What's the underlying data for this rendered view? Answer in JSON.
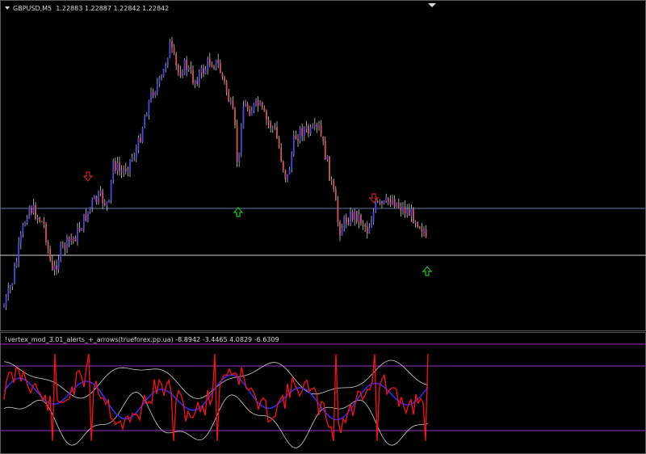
{
  "header": {
    "symbol": "GBPUSD,M5",
    "open": "1.22883",
    "high": "1.22887",
    "low": "1.22842",
    "close": "1.22842"
  },
  "indicator": {
    "name": "!vertex_mod_3.01_alerts_+_arrows(trueforex.pp.ua)",
    "values": [
      "-8.8942",
      "-3.4465",
      "4.0829",
      "-6.6309"
    ]
  },
  "colors": {
    "background": "#000000",
    "bull_body": "#4a4ad8",
    "bear_body": "#d05858",
    "wick": "#c8c8c8",
    "hline_blue": "#5a7fa8",
    "hline_white": "#d8d8d8",
    "arrow_up": "#20c020",
    "arrow_down": "#d02020",
    "ind_red": "#ff1010",
    "ind_blue": "#3030ff",
    "ind_white": "#d0d0d0",
    "ind_levels": "#9b30c8"
  },
  "icons": {
    "buy_arrow": "arrow-up-icon",
    "sell_arrow": "arrow-down-icon",
    "dropdown": "triangle-down-icon"
  }
}
